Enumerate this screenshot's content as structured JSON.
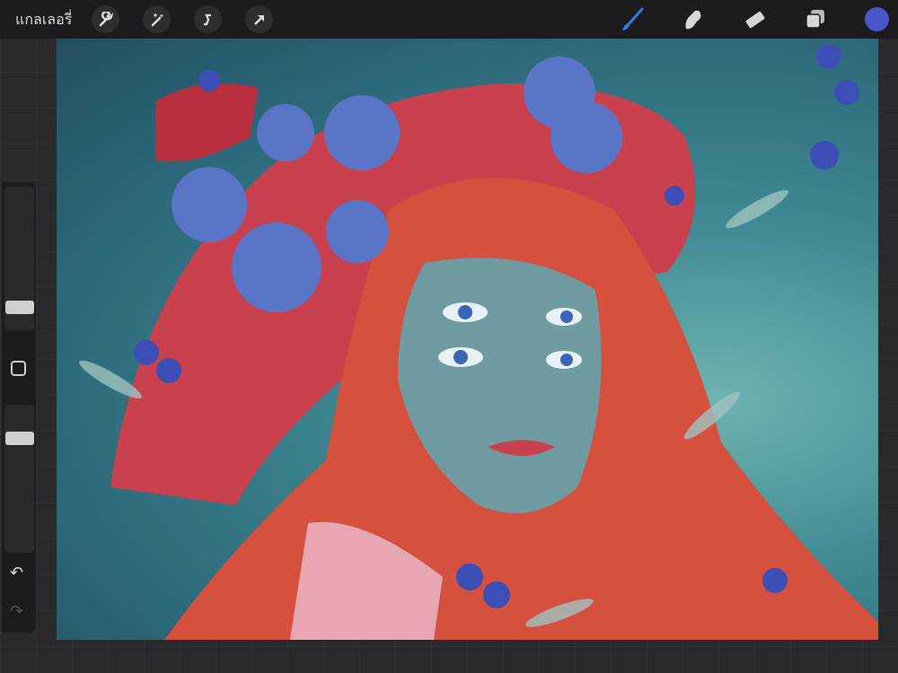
{
  "topbar": {
    "gallery_label": "แกลเลอรี่",
    "left_tools": [
      "wrench-icon",
      "magic-wand-icon",
      "selection-icon",
      "transform-arrow-icon"
    ],
    "right_tools": [
      "brush-icon",
      "smudge-icon",
      "eraser-icon",
      "layers-icon"
    ],
    "active_color": "#4a55c8",
    "brush_color": "#2d7be0"
  },
  "sidebar": {
    "undo": "↶",
    "redo": "↷"
  }
}
